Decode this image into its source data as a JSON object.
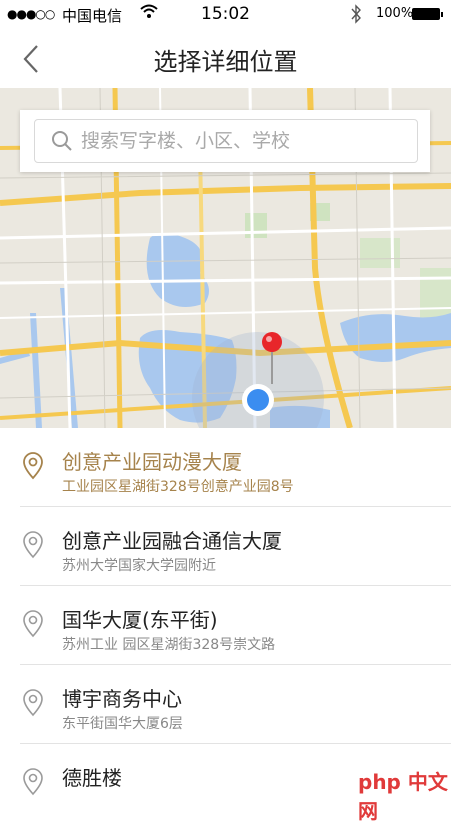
{
  "status_bar": {
    "signal": "●●●○○",
    "carrier": "中国电信",
    "time": "15:02",
    "battery": "100%"
  },
  "nav": {
    "title": "选择详细位置"
  },
  "search": {
    "placeholder": "搜索写字楼、小区、学校"
  },
  "places": [
    {
      "name": "创意产业园动漫大厦",
      "address": "工业园区星湖街328号创意产业园8号",
      "selected": true
    },
    {
      "name": "创意产业园融合通信大厦",
      "address": "苏州大学国家大学园附近",
      "selected": false
    },
    {
      "name": "国华大厦(东平街)",
      "address": "苏州工业 园区星湖街328号崇文路",
      "selected": false
    },
    {
      "name": "博宇商务中心",
      "address": "东平街国华大厦6层",
      "selected": false
    },
    {
      "name": "德胜楼",
      "address": "",
      "selected": false
    }
  ],
  "watermark": "php 中文网",
  "colors": {
    "selected": "#a6834c",
    "map_pin": "#e8262a",
    "location_dot": "#3b8df0"
  }
}
